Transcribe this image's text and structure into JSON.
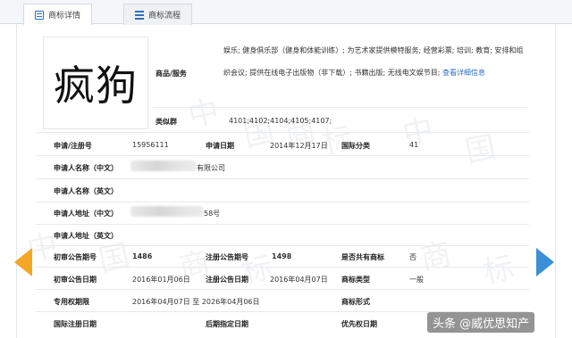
{
  "tabs": [
    {
      "label": "商标详情",
      "icon": "document-icon",
      "active": true
    },
    {
      "label": "商标流程",
      "icon": "list-icon",
      "active": false
    }
  ],
  "mark": {
    "text": "疯狗"
  },
  "goods": {
    "label": "商品/服务",
    "text": "娱乐; 健身俱乐部（健身和体能训练）; 为艺术家提供模特服务; 经营彩票; 培训; 教育; 安排和组织会议; 提供在线电子出版物（非下载）; 书籍出版; 无线电文娱节目;",
    "link": "查看详细信息"
  },
  "similar_group": {
    "label": "类似群",
    "value": "4101;4102;4104;4105;4107;"
  },
  "rows": {
    "reg_no_label": "申请/注册号",
    "reg_no": "15956111",
    "apply_date_label": "申请日期",
    "apply_date": "2014年12月17日",
    "intl_class_label": "国际分类",
    "intl_class": "41",
    "applicant_cn_label": "申请人名称（中文）",
    "applicant_cn_suffix": "有限公司",
    "applicant_en_label": "申请人名称（英文）",
    "address_cn_label": "申请人地址（中文）",
    "address_cn_suffix": "58号",
    "address_en_label": "申请人地址（英文）",
    "prelim_no_label": "初审公告期号",
    "prelim_no": "1486",
    "reg_pub_no_label": "注册公告期号",
    "reg_pub_no": "1498",
    "shared_label": "是否共有商标",
    "shared": "否",
    "prelim_date_label": "初审公告日期",
    "prelim_date": "2016年01月06日",
    "reg_pub_date_label": "注册公告日期",
    "reg_pub_date": "2016年04月07日",
    "mark_type_label": "商标类型",
    "mark_type": "一般",
    "exclusive_label": "专用权期限",
    "exclusive": "2016年04月07日 至 2026年04月06日",
    "form_label": "商标形式",
    "intl_reg_date_label": "国际注册日期",
    "later_date_label": "后期指定日期",
    "priority_date_label": "优先权日期"
  },
  "watermark": [
    "中",
    "国",
    "商",
    "标"
  ],
  "credit": "头条 @威优思知产",
  "colors": {
    "accent": "#2e6fbf",
    "arrow_left": "#f5a623",
    "arrow_right": "#3a8fd6"
  }
}
